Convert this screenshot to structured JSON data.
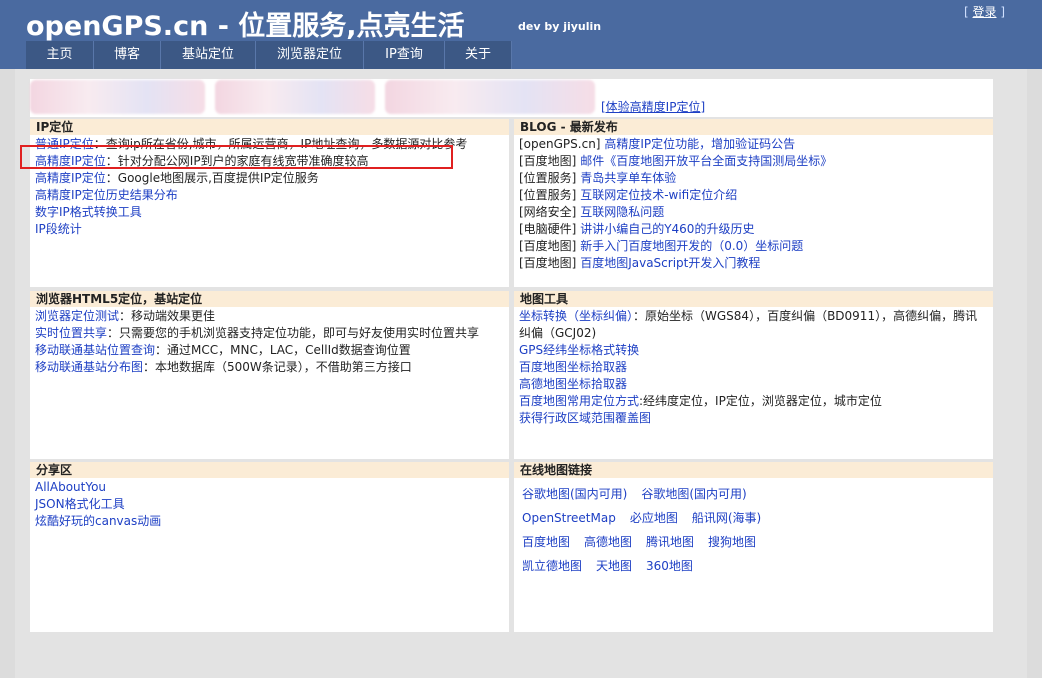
{
  "header": {
    "title": "openGPS.cn - 位置服务,点亮生活",
    "subtitle": "dev by jiyulin",
    "login_label": "登录",
    "bracket_left": "[",
    "bracket_right": "]"
  },
  "nav": [
    "主页",
    "博客",
    "基站定位",
    "浏览器定位",
    "IP查询",
    "关于"
  ],
  "banner": {
    "link": "[体验高精度IP定位]"
  },
  "ip_panel": {
    "title": "IP定位",
    "items": [
      {
        "link": "普通IP定位",
        "text": "：查询ip所在省份,城市，所属运营商，IP地址查询，多数据源对比参考"
      },
      {
        "link": "高精度IP定位",
        "text": "：针对分配公网IP到户的家庭有线宽带准确度较高"
      },
      {
        "link": "高精度IP定位",
        "text": "：Google地图展示,百度提供IP定位服务"
      },
      {
        "link": "高精度IP定位历史结果分布",
        "text": ""
      },
      {
        "link": "数字IP格式转换工具",
        "text": ""
      },
      {
        "link": "IP段统计",
        "text": ""
      }
    ]
  },
  "blog_panel": {
    "title": "BLOG - 最新发布",
    "items": [
      {
        "tag": "[openGPS.cn]",
        "link": "高精度IP定位功能，增加验证码公告"
      },
      {
        "tag": "[百度地图]",
        "link": "邮件《百度地图开放平台全面支持国测局坐标》"
      },
      {
        "tag": "[位置服务]",
        "link": "青岛共享单车体验"
      },
      {
        "tag": "[位置服务]",
        "link": "互联网定位技术-wifi定位介绍"
      },
      {
        "tag": "[网络安全]",
        "link": "互联网隐私问题"
      },
      {
        "tag": "[电脑硬件]",
        "link": "讲讲小编自己的Y460的升级历史"
      },
      {
        "tag": "[百度地图]",
        "link": "新手入门百度地图开发的（0.0）坐标问题"
      },
      {
        "tag": "[百度地图]",
        "link": "百度地图JavaScript开发入门教程"
      }
    ]
  },
  "browser_panel": {
    "title": "浏览器HTML5定位，基站定位",
    "items": [
      {
        "link": "浏览器定位测试",
        "text": "：移动端效果更佳"
      },
      {
        "link": "实时位置共享",
        "text": "：只需要您的手机浏览器支持定位功能，即可与好友使用实时位置共享"
      },
      {
        "link": "移动联通基站位置查询",
        "text": "：通过MCC，MNC，LAC，CellId数据查询位置"
      },
      {
        "link": "移动联通基站分布图",
        "text": "：本地数据库（500W条记录），不借助第三方接口"
      }
    ]
  },
  "maptools_panel": {
    "title": "地图工具",
    "items": [
      {
        "link": "坐标转换（坐标纠偏）",
        "text": "：原始坐标（WGS84），百度纠偏（BD0911），高德纠偏，腾讯纠偏（GCJ02)"
      },
      {
        "link": "GPS经纬坐标格式转换",
        "text": ""
      },
      {
        "link": "百度地图坐标拾取器",
        "text": ""
      },
      {
        "link": "高德地图坐标拾取器",
        "text": ""
      },
      {
        "link": "百度地图常用定位方式",
        "text": ":经纬度定位，IP定位，浏览器定位，城市定位"
      },
      {
        "link": "获得行政区域范围覆盖图",
        "text": ""
      }
    ]
  },
  "share_panel": {
    "title": "分享区",
    "items": [
      "AllAboutYou",
      "JSON格式化工具",
      "炫酷好玩的canvas动画"
    ]
  },
  "online_maps_panel": {
    "title": "在线地图链接",
    "rows": [
      [
        "谷歌地图(国内可用)",
        "谷歌地图(国内可用)"
      ],
      [
        "OpenStreetMap",
        "必应地图",
        "船讯网(海事)"
      ],
      [
        "百度地图",
        "高德地图",
        "腾讯地图",
        "搜狗地图"
      ],
      [
        "凯立德地图",
        "天地图",
        "360地图"
      ]
    ]
  }
}
